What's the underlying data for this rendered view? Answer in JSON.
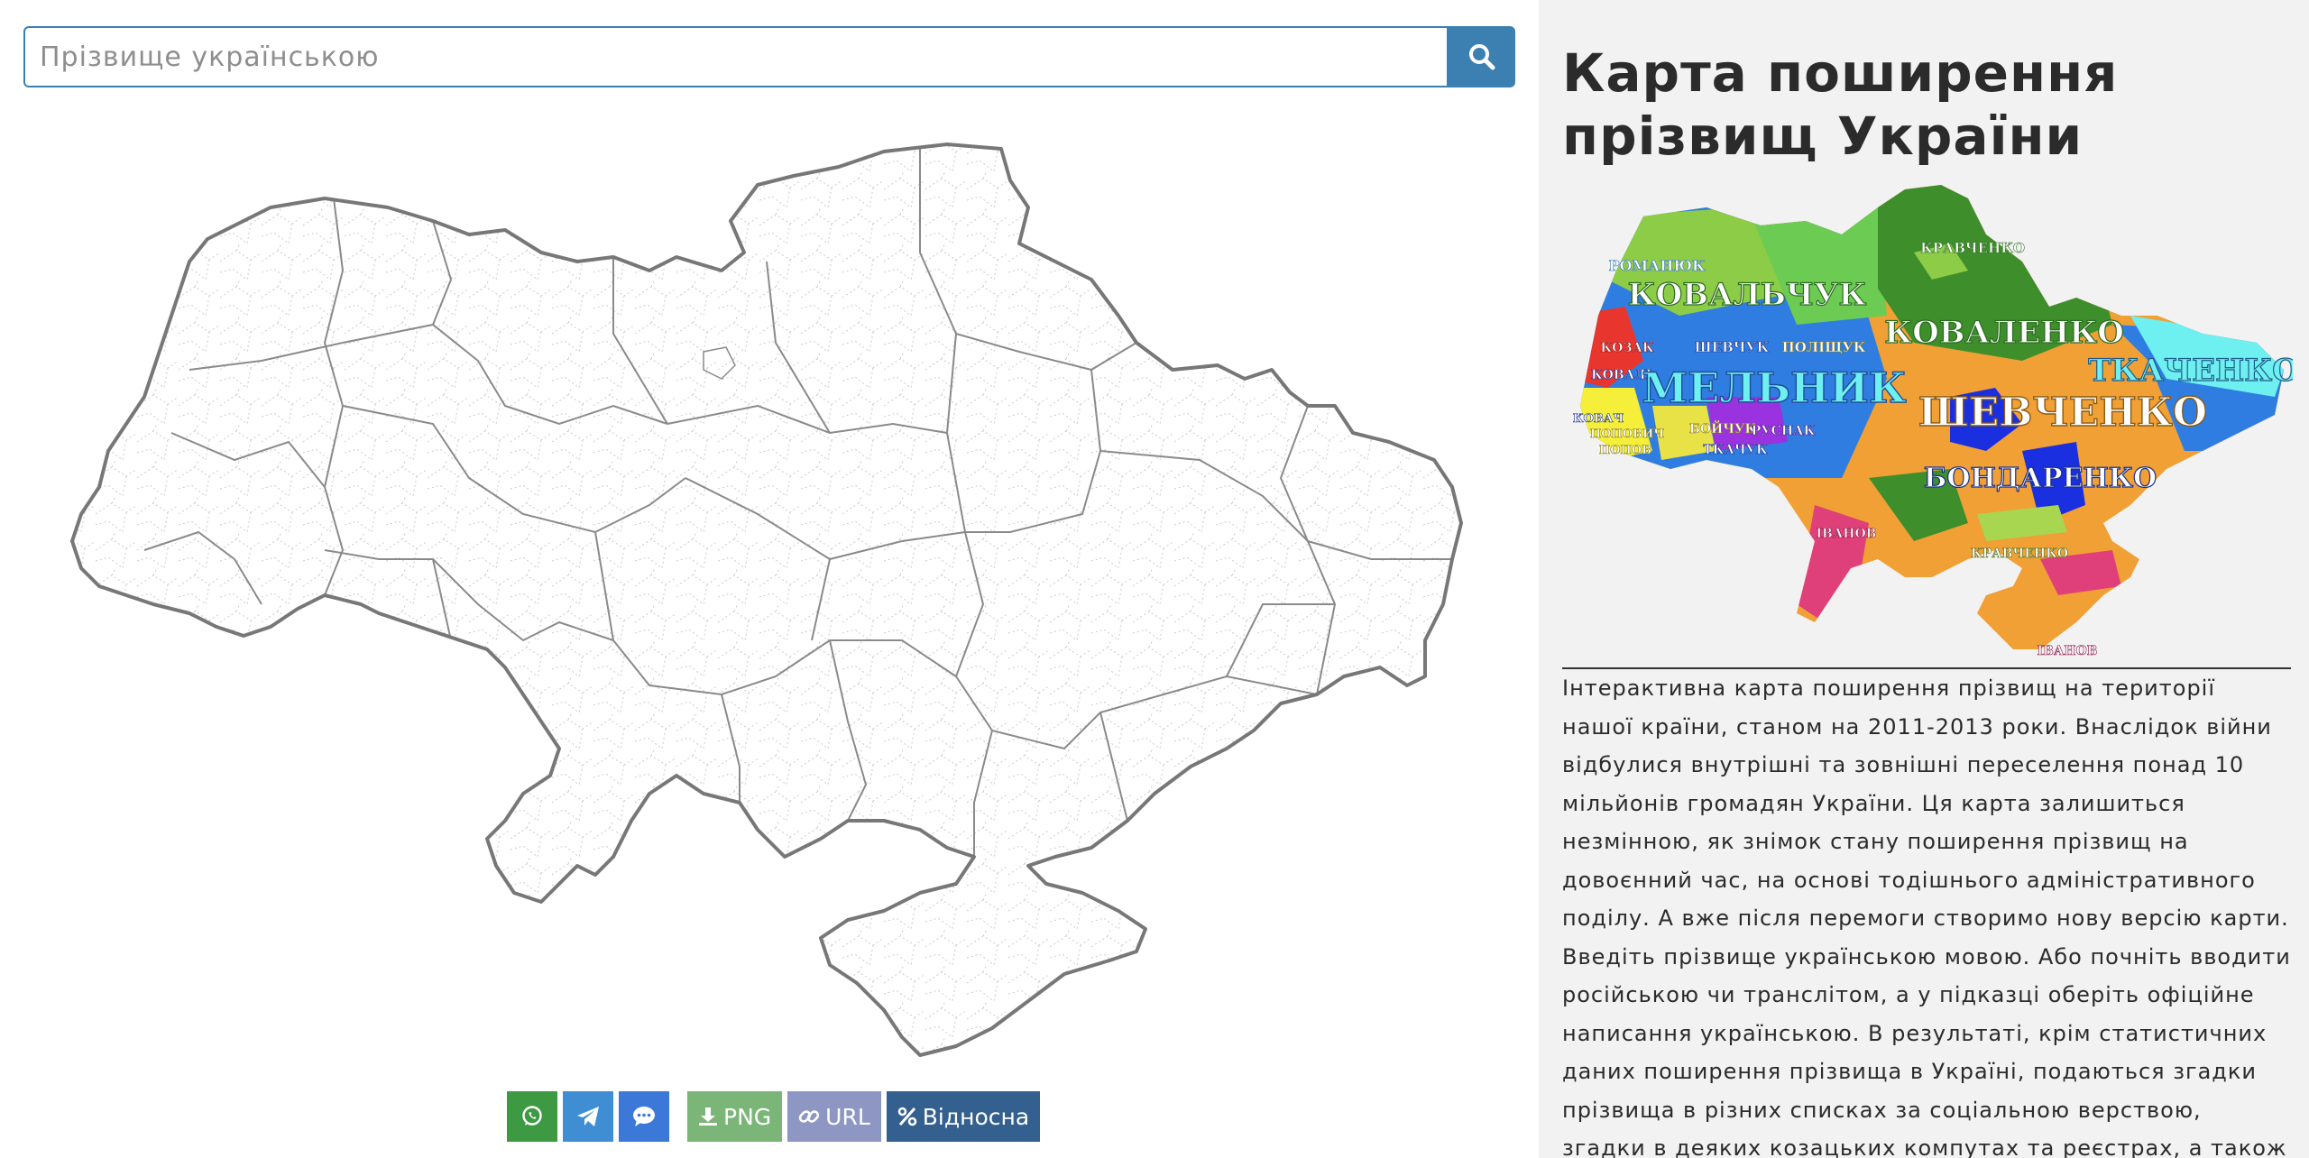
{
  "search": {
    "placeholder": "Прізвище українською",
    "icon": "search-icon"
  },
  "toolbar": {
    "share": [
      {
        "name": "whatsapp",
        "icon": "whatsapp-icon",
        "color": "#3d9a43"
      },
      {
        "name": "telegram",
        "icon": "telegram-icon",
        "color": "#3f8ed4"
      },
      {
        "name": "messenger",
        "icon": "chat-icon",
        "color": "#3c78d8"
      }
    ],
    "png_label": "PNG",
    "png_color": "#7cb578",
    "url_label": "URL",
    "url_color": "#8e96c4",
    "relative_label": "Відносна",
    "relative_color": "#33608e"
  },
  "panel": {
    "title": "Карта поширення прізвищ України",
    "background": "#f2f2f2",
    "description": "Інтерактивна карта поширення прізвищ на території нашої країни, станом на 2011-2013 роки. Внаслідок війни відбулися внутрішні та зовнішні переселення понад 10 мільйонів громадян України. Ця карта залишиться незмінною, як знімок стану поширення прізвищ на довоєнний час, на основі тодішнього адміністративного поділу. А вже після перемоги створимо нову версію карти. Введіть прізвище українською мовою. Або почніть вводити російською чи транслітом, а у підказці оберіть офіційне написання українською. В результаті, крім статистичних даних поширення прізвища в Україні, подаються згадки прізвища в різних списках за соціальною верствою, згадки в деяких козацьких компутах та реєстрах, а також"
  },
  "preview_map": {
    "labels": [
      {
        "text": "РОМАНЮК",
        "size": "small"
      },
      {
        "text": "КОВАЛЬЧУК",
        "size": "large"
      },
      {
        "text": "КРАВЧЕНКО",
        "size": "small"
      },
      {
        "text": "КОВАЛЕНКО",
        "size": "large"
      },
      {
        "text": "КОЗАК",
        "size": "small"
      },
      {
        "text": "ШЕВЧУК",
        "size": "small"
      },
      {
        "text": "ПОЛІЩУК",
        "size": "small"
      },
      {
        "text": "ТКАЧЕНКО",
        "size": "large"
      },
      {
        "text": "КОВАЛЬ",
        "size": "small"
      },
      {
        "text": "МЕЛЬНИК",
        "size": "xlarge"
      },
      {
        "text": "ШЕВЧЕНКО",
        "size": "xlarge"
      },
      {
        "text": "КОВАЧ",
        "size": "small"
      },
      {
        "text": "БОЙЧУК",
        "size": "small"
      },
      {
        "text": "РУСНАК",
        "size": "small"
      },
      {
        "text": "ПОПОВИЧ",
        "size": "small"
      },
      {
        "text": "ТКАЧУК",
        "size": "small"
      },
      {
        "text": "ПОПОВ",
        "size": "small"
      },
      {
        "text": "БОНДАРЕНКО",
        "size": "large"
      },
      {
        "text": "ІВАНОВ",
        "size": "small"
      },
      {
        "text": "КРАВЧЕНКО",
        "size": "small"
      },
      {
        "text": "ІВАНОВ",
        "size": "small"
      }
    ],
    "colors": {
      "orange": "#f0a035",
      "green": "#3e8e2c",
      "lightgreen": "#8ccc46",
      "blue": "#2f7de1",
      "darkblue": "#1a2fe0",
      "cyan": "#6ff0f0",
      "pink": "#e0407a"
    }
  }
}
